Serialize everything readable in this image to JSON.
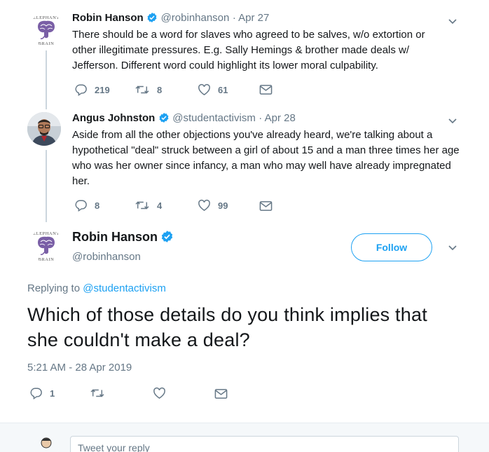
{
  "tweets": [
    {
      "name": "Robin Hanson",
      "handle": "@robinhanson",
      "date": "· Apr 27",
      "text": "There should be a word for slaves who agreed to be salves, w/o extortion or other illegitimate pressures. E.g. Sally Hemings & brother made deals w/ Jefferson. Different word could highlight its lower moral culpability.",
      "replies": "219",
      "retweets": "8",
      "likes": "61"
    },
    {
      "name": "Angus Johnston",
      "handle": "@studentactivism",
      "date": "· Apr 28",
      "text": "Aside from all the other objections you've already heard, we're talking about a hypothetical \"deal\" struck between a girl of about 15 and a man three times her age who was her owner since infancy, a man who may well have already impregnated her.",
      "replies": "8",
      "retweets": "4",
      "likes": "99"
    }
  ],
  "avatar_brain": {
    "top_text": "ELEPHANT",
    "bottom_text": "BRAIN"
  },
  "main_tweet": {
    "name": "Robin Hanson",
    "handle": "@robinhanson",
    "follow_label": "Follow",
    "replying_prefix": "Replying to",
    "replying_handle": "@studentactivism",
    "text": "Which of those details do you think implies that she couldn't make a deal?",
    "timestamp": "5:21 AM - 28 Apr 2019",
    "replies": "1"
  },
  "reply": {
    "placeholder": "Tweet your reply"
  },
  "colors": {
    "accent": "#1da1f2",
    "text": "#14171a",
    "muted": "#657786",
    "brain_purple": "#7a5fa6"
  },
  "icons": [
    "chevron-down-icon",
    "verified-badge-icon",
    "reply-icon",
    "retweet-icon",
    "like-icon",
    "dm-icon"
  ]
}
